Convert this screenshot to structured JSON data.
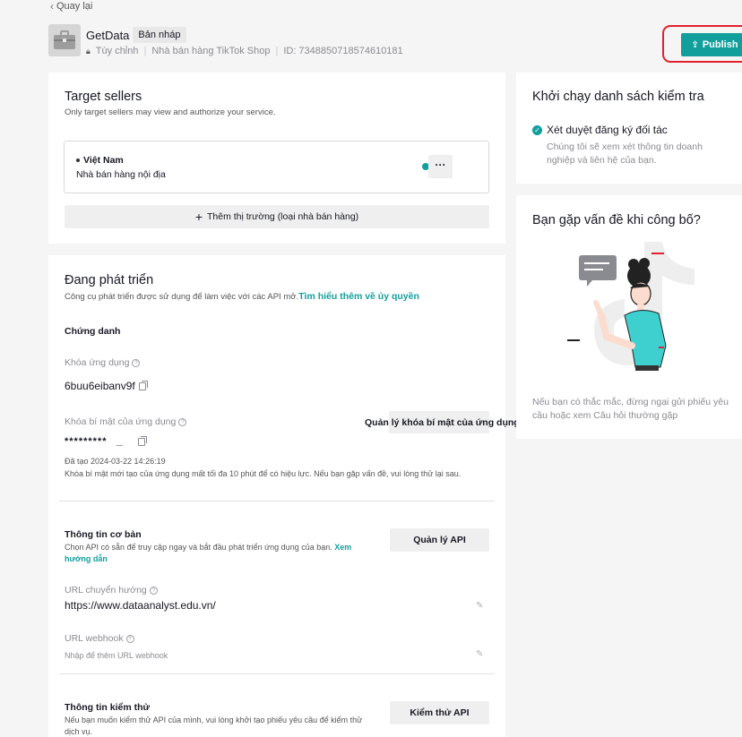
{
  "nav": {
    "back_label": "Quay lại"
  },
  "app": {
    "name": "GetData",
    "status_badge": "Bản nháp",
    "type": "Tùy chỉnh",
    "category": "Nhà bán hàng TikTok Shop",
    "id_text": "ID: 7348850718574610181"
  },
  "publish": {
    "label": "Publish"
  },
  "target_sellers": {
    "title": "Target sellers",
    "subtitle": "Only target sellers may view and authorize your service.",
    "market": {
      "name": "Việt Nam",
      "desc": "Nhà bán hàng nội địa",
      "more": "···"
    },
    "add_market": "Thêm thị trường (loại nhà bán hàng)"
  },
  "development": {
    "title": "Đang phát triển",
    "subtitle": "Công cụ phát triển được sử dụng để làm việc với các API mở.",
    "learn_link": "Tìm hiểu thêm về ủy quyền",
    "credentials_heading": "Chứng danh",
    "app_key_label": "Khóa ứng dụng",
    "app_key_value": "6buu6eibanv9f",
    "secret_label": "Khóa bí mật của ứng dụng",
    "manage_secret_button": "Quản lý khóa bí mật của ứng dụng",
    "secret_value": "*********",
    "created_at": "Đã tạo 2024-03-22 14:26:19",
    "secret_note": "Khóa bí mật mới tạo của ứng dụng mất tối đa 10 phút để có hiệu lực. Nếu bạn gặp vấn đề, vui lòng thử lại sau.",
    "basic_info_heading": "Thông tin cơ bản",
    "basic_info_desc": "Chọn API có sẵn để truy cập ngay và bắt đầu phát triển ứng dụng của bạn.",
    "basic_info_link_1": "Xem",
    "basic_info_link_2": "hướng dẫn",
    "manage_api_button": "Quản lý API",
    "redirect_label": "URL chuyển hướng",
    "redirect_value": "https://www.dataanalyst.edu.vn/",
    "webhook_label": "URL webhook",
    "webhook_placeholder": "Nhập để thêm URL webhook",
    "test_heading": "Thông tin kiểm thử",
    "test_desc_1": "Nếu bạn muốn kiểm thử API của mình, vui lòng khởi tạo phiếu yêu cầu để kiểm thử",
    "test_desc_2": "dịch vụ.",
    "test_api_button": "Kiểm thử API"
  },
  "checklist": {
    "title": "Khởi chạy danh sách kiểm tra",
    "item_title": "Xét duyệt đăng ký đối tác",
    "item_desc": "Chúng tôi sẽ xem xét thông tin doanh nghiệp và liên hệ của bạn."
  },
  "help": {
    "title": "Bạn gặp vấn đề khi công bố?",
    "desc": "Nếu bạn có thắc mắc, đừng ngại gửi phiếu yêu cầu hoặc xem Câu hỏi thường gặp"
  },
  "colors": {
    "accent": "#129f9c",
    "highlight": "#e3202c",
    "background": "#f5f5f5"
  }
}
